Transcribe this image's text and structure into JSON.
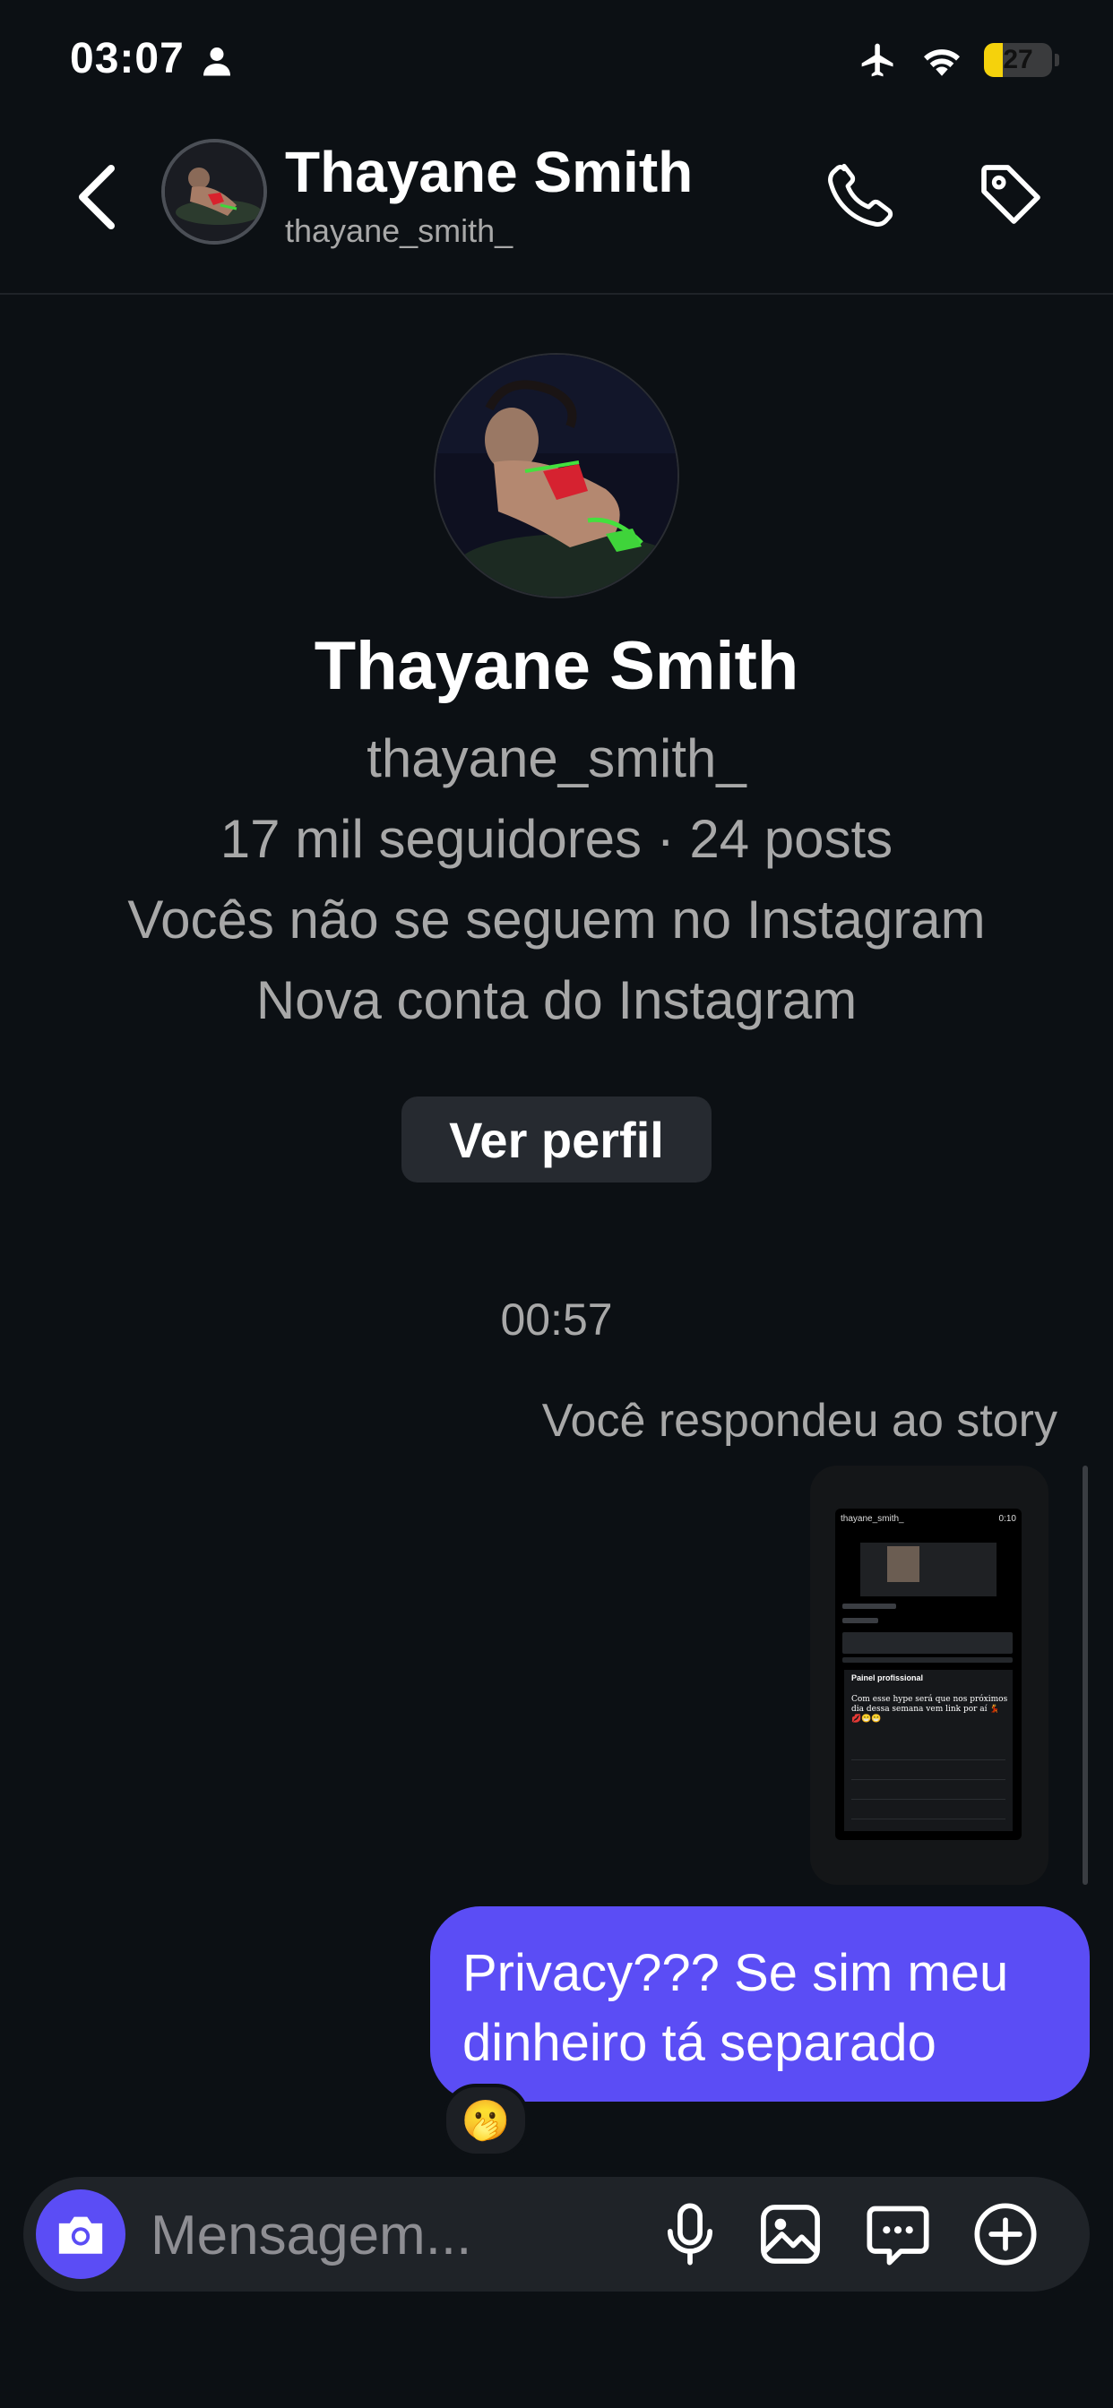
{
  "status_bar": {
    "time": "03:07",
    "battery_level": "27",
    "battery_fraction": 0.27
  },
  "header": {
    "name": "Thayane Smith",
    "username": "thayane_smith_"
  },
  "profile": {
    "name": "Thayane Smith",
    "username": "thayane_smith_",
    "stats": "17 mil seguidores · 24 posts",
    "follow_status": "Vocês não se seguem no Instagram",
    "account_note": "Nova conta do Instagram",
    "view_profile_label": "Ver perfil"
  },
  "conversation": {
    "timestamp": "00:57",
    "story_reply_label": "Você respondeu ao story",
    "story_preview": {
      "username": "thayane_smith_",
      "duration": "0:10",
      "panel_title": "Painel profissional",
      "caption": "Com esse hype será que nos próximos dia dessa semana vem link por aí 💃💋😁😁"
    },
    "message": {
      "text": "Privacy??? Se sim meu dinheiro tá separado",
      "reaction": "🫢"
    }
  },
  "composer": {
    "placeholder": "Mensagem..."
  },
  "colors": {
    "background": "#0c1014",
    "accent": "#5b4df5",
    "battery": "#f5d20c"
  }
}
